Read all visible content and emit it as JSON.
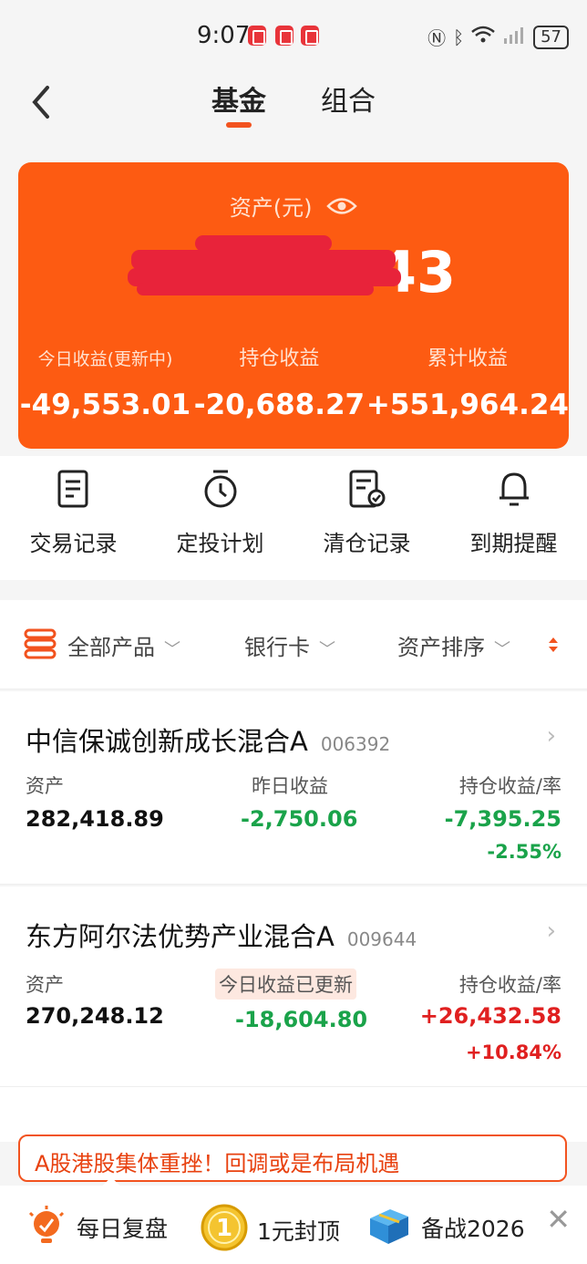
{
  "status": {
    "time": "9:07",
    "battery": "57"
  },
  "nav": {
    "tabs": [
      "基金",
      "组合"
    ]
  },
  "asset": {
    "label": "资产(元)",
    "amount_visible": "43",
    "stats": [
      {
        "label": "今日收益(更新中)",
        "value": "-49,553.01"
      },
      {
        "label": "持仓收益",
        "value": "-20,688.27"
      },
      {
        "label": "累计收益",
        "value": "+551,964.24"
      }
    ]
  },
  "actions": [
    {
      "label": "交易记录",
      "icon": "document-icon"
    },
    {
      "label": "定投计划",
      "icon": "timer-icon"
    },
    {
      "label": "清仓记录",
      "icon": "cleared-record-icon"
    },
    {
      "label": "到期提醒",
      "icon": "bell-icon"
    }
  ],
  "filters": {
    "all": "全部产品",
    "bank": "银行卡",
    "sort": "资产排序"
  },
  "funds": [
    {
      "name": "中信保诚创新成长混合A",
      "code": "006392",
      "h_asset": "资产",
      "asset": "282,418.89",
      "h_mid": "昨日收益",
      "mid": "-2,750.06",
      "h_hold": "持仓收益/率",
      "hold": "-7,395.25",
      "rate": "-2.55%"
    },
    {
      "name": "东方阿尔法优势产业混合A",
      "code": "009644",
      "h_asset": "资产",
      "asset": "270,248.12",
      "h_mid": "今日收益已更新",
      "mid": "-18,604.80",
      "h_hold": "持仓收益/率",
      "hold": "+26,432.58",
      "rate": "+10.84%"
    }
  ],
  "banner": {
    "text": "A股港股集体重挫！回调或是布局机遇"
  },
  "bottombar": [
    "每日复盘",
    "1元封顶",
    "备战2026"
  ],
  "colors": {
    "accent": "#fd5b12",
    "green": "#1aa34a",
    "red": "#e02020"
  }
}
